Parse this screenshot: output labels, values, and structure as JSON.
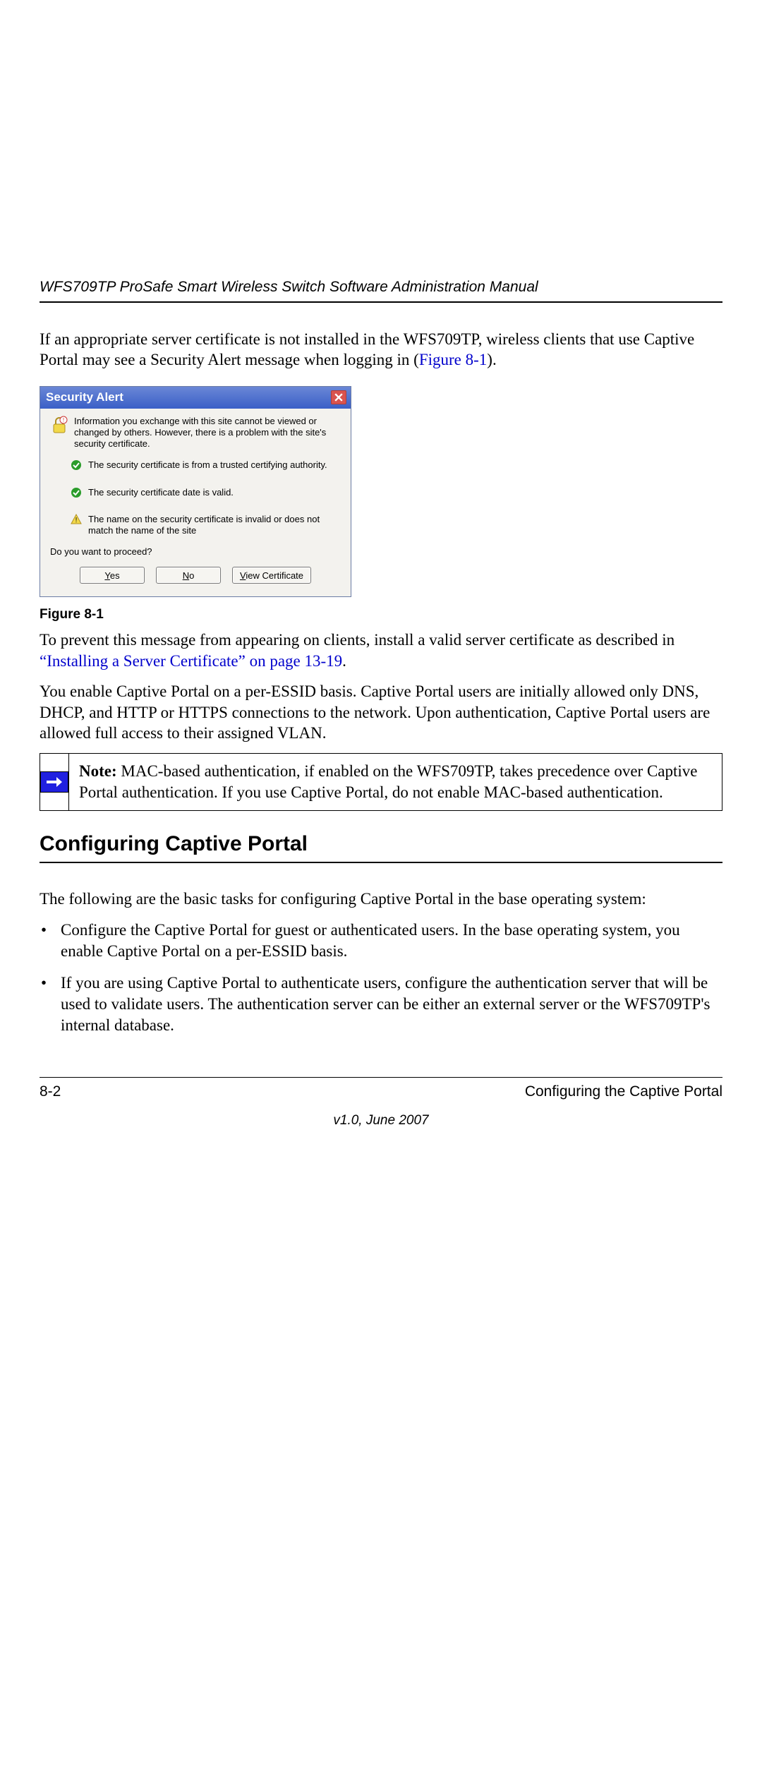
{
  "header": {
    "running_title": "WFS709TP ProSafe Smart Wireless Switch Software Administration Manual"
  },
  "intro": {
    "text_before_link": "If an appropriate server certificate is not installed in the WFS709TP, wireless clients that use Captive Portal may see a Security Alert message when logging in (",
    "link": "Figure 8-1",
    "text_after_link": ")."
  },
  "dialog": {
    "title": "Security Alert",
    "info_text": "Information you exchange with this site cannot be viewed or changed by others. However, there is a problem with the site's security certificate.",
    "check1": "The security certificate is from a trusted certifying authority.",
    "check2": "The security certificate date is valid.",
    "warn": "The name on the security certificate is invalid or does not match the name of the site",
    "prompt": "Do you want to proceed?",
    "buttons": {
      "yes": "Yes",
      "no": "No",
      "view": "View Certificate"
    }
  },
  "figure_caption": "Figure 8-1",
  "para1": {
    "before": "To prevent this message from appearing on clients, install a valid server certificate as described in ",
    "link": "“Installing a Server Certificate” on page 13-19",
    "after": "."
  },
  "para2": "You enable Captive Portal on a per-ESSID basis. Captive Portal users are initially allowed only DNS, DHCP, and HTTP or HTTPS connections to the network. Upon authentication, Captive Portal users are allowed full access to their assigned VLAN.",
  "note": {
    "label": "Note:",
    "body": " MAC-based authentication, if enabled on the WFS709TP, takes precedence over Captive Portal authentication. If you use Captive Portal, do not enable MAC-based authentication."
  },
  "section_heading": "Configuring Captive Portal",
  "section_intro": "The following are the basic tasks for configuring Captive Portal in the base operating system:",
  "bullets": [
    "Configure the Captive Portal for guest or authenticated users. In the base operating system, you enable Captive Portal on a per-ESSID basis.",
    "If you are using Captive Portal to authenticate users, configure the authentication server that will be used to validate users. The authentication server can be either an external server or the WFS709TP's internal database."
  ],
  "footer": {
    "page": "8-2",
    "section": "Configuring the Captive Portal",
    "version": "v1.0, June 2007"
  }
}
